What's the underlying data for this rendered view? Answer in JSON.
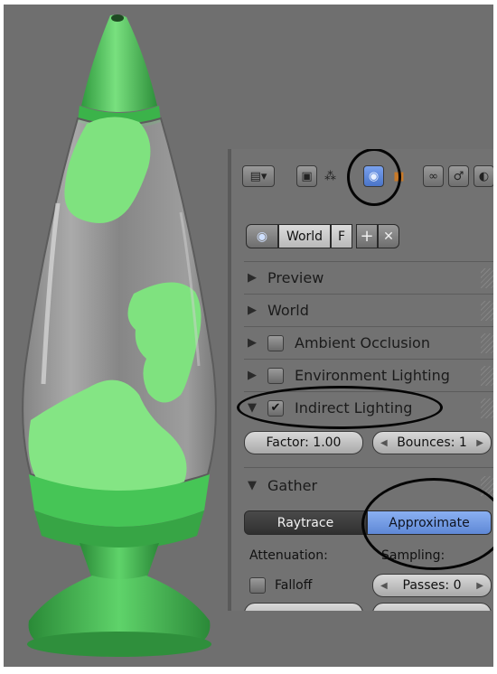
{
  "colors": {
    "lava": "#7fe27f",
    "lamp_green": "#4fcf5f",
    "panel_bg": "#727272",
    "active_tab": "#5a86d8",
    "selected_button": "#6f9be8"
  },
  "properties": {
    "tabs": [
      {
        "icon": "render-layers-icon"
      },
      {
        "icon": "scene-icon"
      },
      {
        "icon": "world-icon",
        "active": true
      },
      {
        "icon": "object-icon"
      },
      {
        "icon": "constraints-icon"
      },
      {
        "icon": "modifiers-icon"
      },
      {
        "icon": "more-icon"
      }
    ],
    "world_selector": {
      "name": "World",
      "fake_user": "F",
      "add_symbol": "+",
      "remove_symbol": "✕"
    },
    "panels": {
      "preview": "Preview",
      "world": "World",
      "ambient_occlusion": {
        "label": "Ambient Occlusion",
        "enabled": false
      },
      "environment_lighting": {
        "label": "Environment Lighting",
        "enabled": false
      },
      "indirect_lighting": {
        "label": "Indirect Lighting",
        "enabled": true
      }
    },
    "indirect": {
      "factor_label": "Factor: 1.00",
      "bounces_label": "Bounces: 1"
    },
    "gather": {
      "label": "Gather",
      "methods": [
        "Raytrace",
        "Approximate"
      ],
      "selected": "Approximate",
      "attenuation_label": "Attenuation:",
      "sampling_label": "Sampling:",
      "falloff_label": "Falloff",
      "falloff_enabled": false,
      "passes_label": "Passes: 0"
    }
  }
}
